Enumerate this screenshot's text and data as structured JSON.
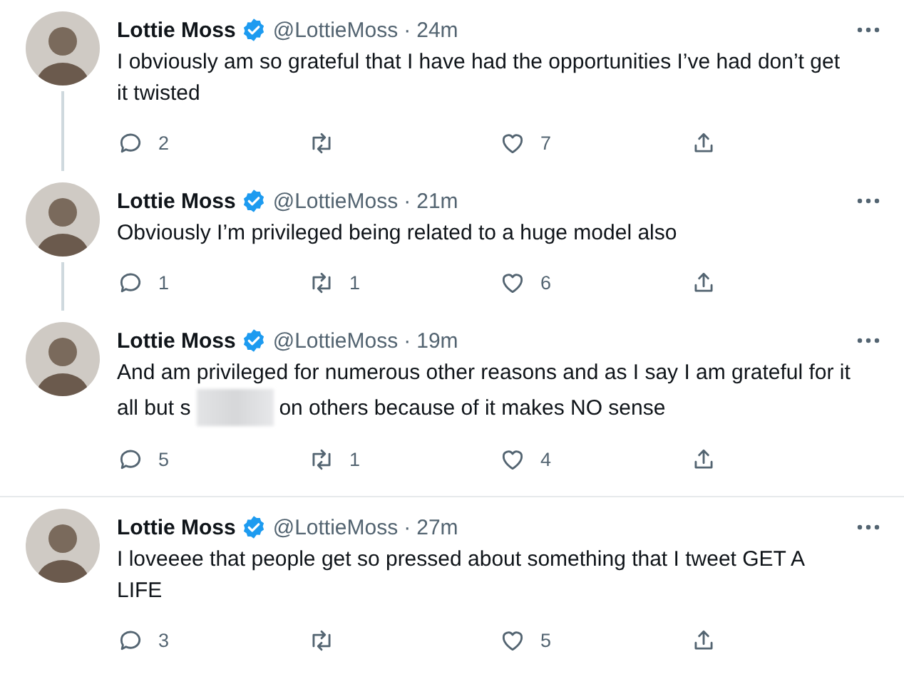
{
  "tweets": [
    {
      "name": "Lottie Moss",
      "verified": true,
      "handle": "@LottieMoss",
      "separator": "·",
      "time": "24m",
      "parts": [
        {
          "kind": "text",
          "text": "I obviously am so grateful that I have had the opportunities I’ve had don’t get it twisted"
        }
      ],
      "replies": "2",
      "likes": "7",
      "thread_line_below": true
    },
    {
      "name": "Lottie Moss",
      "verified": true,
      "handle": "@LottieMoss",
      "separator": "·",
      "time": "21m",
      "parts": [
        {
          "kind": "text",
          "text": "Obviously I’m privileged being related to a huge model also"
        }
      ],
      "replies": "1",
      "retweets": "1",
      "likes": "6",
      "thread_line_below": true
    },
    {
      "name": "Lottie Moss",
      "verified": true,
      "handle": "@LottieMoss",
      "separator": "·",
      "time": "19m",
      "parts": [
        {
          "kind": "text",
          "text": "And am privileged for numerous other reasons and as I say I am grateful for it all but s"
        },
        {
          "kind": "redacted"
        },
        {
          "kind": "text",
          "text": "on others because of it makes NO sense"
        }
      ],
      "replies": "5",
      "retweets": "1",
      "likes": "4",
      "thread_line_below": false
    },
    {
      "name": "Lottie Moss",
      "verified": true,
      "handle": "@LottieMoss",
      "separator": "·",
      "time": "27m",
      "parts": [
        {
          "kind": "text",
          "text": "I loveeee that people get so pressed about something that I tweet GET A LIFE"
        }
      ],
      "replies": "3",
      "likes": "5",
      "thread_line_below": false
    }
  ]
}
